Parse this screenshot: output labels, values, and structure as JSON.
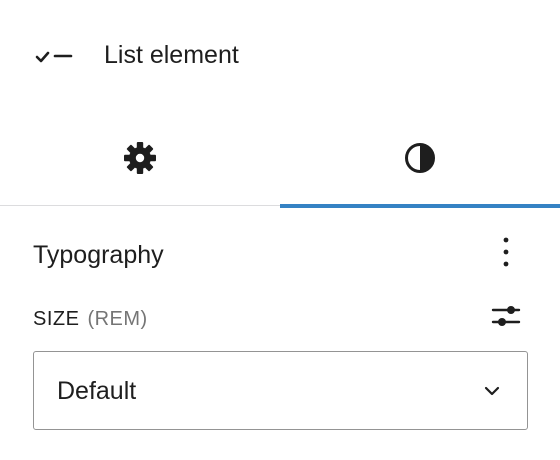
{
  "header": {
    "block_icon": "list-check-icon",
    "title": "List element"
  },
  "tabs": [
    {
      "label": "Settings",
      "icon": "gear-icon",
      "active": false
    },
    {
      "label": "Styles",
      "icon": "half-circle-contrast-icon",
      "active": true
    }
  ],
  "typography": {
    "title": "Typography",
    "options_icon": "vertical-ellipsis-icon",
    "size_label": "SIZE",
    "size_unit": "(REM)",
    "custom_size_icon": "sliders-icon",
    "size_select": {
      "value": "Default",
      "icon": "chevron-down-icon"
    }
  },
  "colors": {
    "accent": "#3582c4",
    "text": "#1e1e1e",
    "muted": "#757575",
    "border": "#949494",
    "divider": "#dcdcde"
  }
}
